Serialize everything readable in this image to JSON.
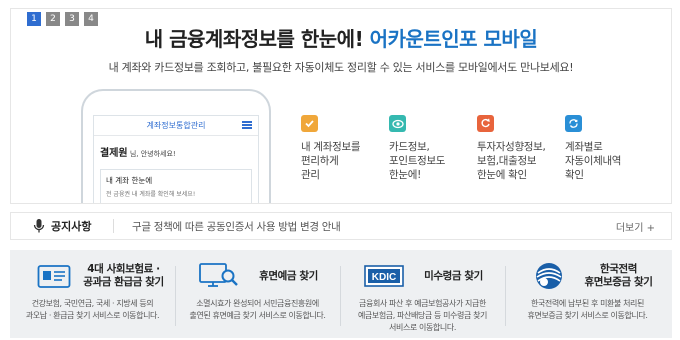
{
  "banner": {
    "pager": [
      "1",
      "2",
      "3",
      "4"
    ],
    "title_main": "내 금융계좌정보를 한눈에! ",
    "title_brand": "어카운트인포 모바일",
    "subtitle": "내 계좌와 카드정보를 조회하고, 불필요한 자동이체도 정리할 수 있는 서비스를 모바일에서도 만나보세요!",
    "phone": {
      "header": "계좌정보통합관리",
      "greeting_name": "결제원",
      "greeting_suffix": " 님, 안녕하세요!",
      "card_title": "내 계좌 한눈에",
      "card_text": "전 금융권 내 계좌를 확인해 보세요!"
    },
    "features": [
      {
        "text": [
          "내 계좌정보를",
          "편리하게",
          "관리"
        ],
        "icon": "check-icon",
        "color": "#f0a73a"
      },
      {
        "text": [
          "카드정보,",
          "포인트정보도",
          "한눈에!"
        ],
        "icon": "eye-icon",
        "color": "#35b9b0"
      },
      {
        "text": [
          "투자자성향정보,",
          "보험,대출정보",
          "한눈에 확인"
        ],
        "icon": "refresh-icon",
        "color": "#e8643c"
      },
      {
        "text": [
          "계좌별로",
          "자동이체내역",
          "확인"
        ],
        "icon": "sync-icon",
        "color": "#2a8fd6"
      }
    ]
  },
  "notice": {
    "label": "공지사항",
    "text": "구글 정책에 따른 공동인증서 사용 방법 변경 안내",
    "more": "더보기 +"
  },
  "services": [
    {
      "title": [
        "4대 사회보험료 ·",
        "공과금 환급금 찾기"
      ],
      "desc": [
        "건강보험, 국민연금, 국세 · 지방세 등의",
        "과오납 · 환급금 찾기 서비스로 이동합니다."
      ],
      "icon": "id-card-icon"
    },
    {
      "title": [
        "휴면예금 찾기"
      ],
      "desc": [
        "소멸시효가 완성되어 서민금융진흥원에",
        "출연된 휴면예금 찾기 서비스로 이동합니다."
      ],
      "icon": "monitor-search-icon"
    },
    {
      "title": [
        "미수령금 찾기"
      ],
      "desc": [
        "금융회사 파산 후 예금보험공사가 지급한",
        "예금보험금, 파산배당금 등 미수령금 찾기",
        "서비스로 이동합니다."
      ],
      "icon": "kdic-logo-icon",
      "logo_text": "KDIC"
    },
    {
      "title": [
        "한국전력",
        "휴면보증금 찾기"
      ],
      "desc": [
        "한국전력에 납부된 후 미환불 처리된",
        "휴면보증금 찾기 서비스로 이동합니다."
      ],
      "icon": "kepco-logo-icon"
    }
  ],
  "colors": {
    "accent": "#1a73c4",
    "pager_active": "#2f6dd0",
    "service_bg": "#eef0f2"
  }
}
